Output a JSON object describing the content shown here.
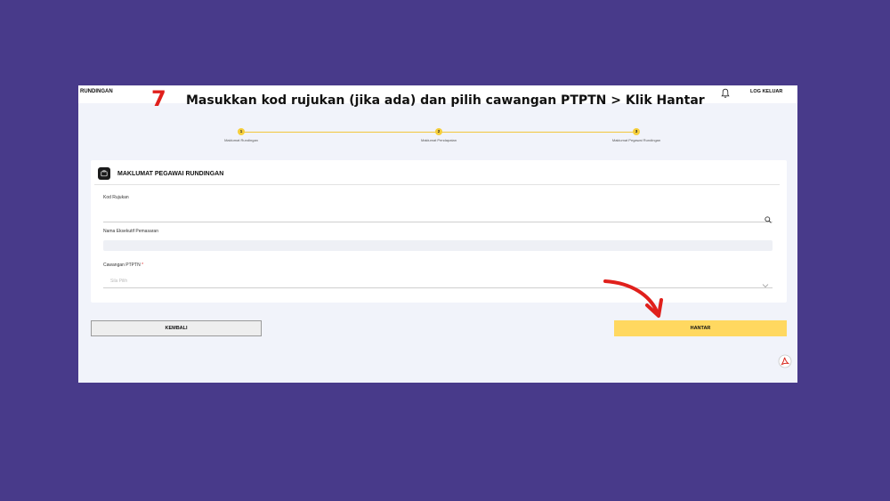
{
  "header": {
    "brand": "RUNDINGAN",
    "logout": "LOG KELUAR"
  },
  "instruction": {
    "step_number": "7",
    "text": "Masukkan kod rujukan (jika ada) dan pilih cawangan PTPTN  > Klik Hantar"
  },
  "stepper": [
    {
      "num": "1",
      "label": "Maklumat Rundingan"
    },
    {
      "num": "2",
      "label": "Maklumat Pendapatan"
    },
    {
      "num": "3",
      "label": "Maklumat Pegawai Rundingan"
    }
  ],
  "card": {
    "title": "MAKLUMAT PEGAWAI RUNDINGAN",
    "fields": {
      "kod_rujukan": {
        "label": "Kod Rujukan",
        "value": ""
      },
      "nama": {
        "label": "Nama Eksekutif Pemasaran",
        "value": ""
      },
      "cawangan": {
        "label": "Cawangan PTPTN",
        "required": "*",
        "placeholder": "Sila Pilih"
      }
    }
  },
  "buttons": {
    "back": "KEMBALI",
    "submit": "HANTAR"
  },
  "colors": {
    "page_background": "#483a8a",
    "accent_yellow": "#ffd860",
    "annotation_red": "#e0201c"
  },
  "icons": [
    "bell-icon",
    "card-icon",
    "search-icon",
    "chevron-down-icon",
    "pdf-icon",
    "arrow-annotation"
  ]
}
